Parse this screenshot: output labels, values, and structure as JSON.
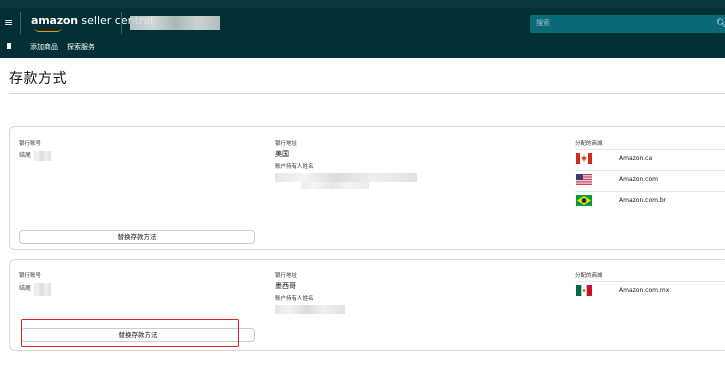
{
  "header": {
    "brand": "amazon",
    "product": "seller central",
    "search_placeholder": "搜索",
    "search_button_icon": "search-icon"
  },
  "subnav": {
    "items": [
      "添加商品",
      "探索服务"
    ]
  },
  "page": {
    "title": "存款方式"
  },
  "cards": [
    {
      "bank_account_label": "银行账号",
      "bank_account_value": "结尾",
      "bank_address_label": "银行地址",
      "bank_address_value": "美国",
      "account_holder_label": "账户持有人姓名",
      "marketplaces_label": "分配的商城",
      "marketplaces": [
        {
          "name": "Amazon.ca",
          "flag": "canada-flag-icon"
        },
        {
          "name": "Amazon.com",
          "flag": "usa-flag-icon"
        },
        {
          "name": "Amazon.com.br",
          "flag": "brazil-flag-icon"
        }
      ],
      "button_label": "替换存款方法"
    },
    {
      "bank_account_label": "银行账号",
      "bank_account_value": "结尾",
      "bank_address_label": "银行地址",
      "bank_address_value": "墨西哥",
      "account_holder_label": "账户持有人姓名",
      "marketplaces_label": "分配的商城",
      "marketplaces": [
        {
          "name": "Amazon.com.mx",
          "flag": "mexico-flag-icon"
        }
      ],
      "button_label": "替换存款方法"
    }
  ],
  "colors": {
    "topbar": "#002f36",
    "search": "#0b6a78",
    "highlight": "#e02020",
    "logo_smile": "#ff9900"
  }
}
